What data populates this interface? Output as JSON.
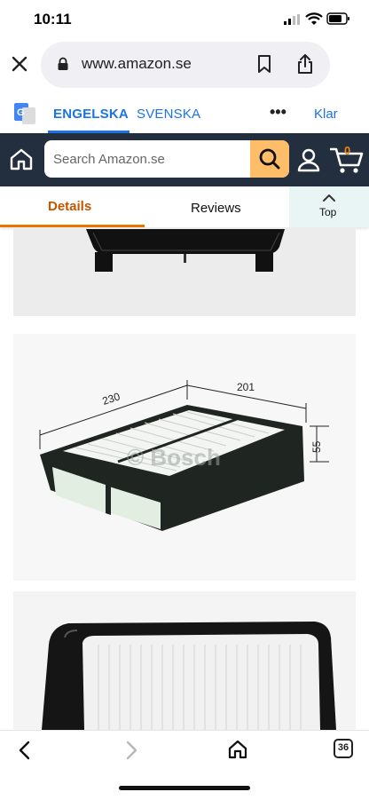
{
  "status_bar": {
    "time": "10:11"
  },
  "browser": {
    "url": "www.amazon.se"
  },
  "translate_bar": {
    "source_language": "ENGELSKA",
    "target_language": "SVENSKA",
    "more": "•••",
    "done": "Klar"
  },
  "amazon_header": {
    "search_placeholder": "Search Amazon.se",
    "cart_count": "0"
  },
  "tabs": {
    "details": "Details",
    "reviews": "Reviews",
    "top": "Top"
  },
  "product_images": {
    "diagram": {
      "dim_length": "230",
      "dim_width": "201",
      "dim_height": "55",
      "watermark": "© Bosch"
    }
  },
  "bottom_toolbar": {
    "tab_count": "36"
  },
  "colors": {
    "amazon_header_bg": "#232f3e",
    "search_button": "#febd69",
    "tab_active": "#c45500",
    "translate_blue": "#1a73e8"
  },
  "icons": {
    "close": "close-icon",
    "lock": "lock-icon",
    "bookmark": "bookmark-icon",
    "share": "share-icon",
    "translate": "google-translate-icon",
    "home": "home-icon",
    "search": "search-icon",
    "account": "account-icon",
    "cart": "cart-icon",
    "back": "back-arrow-icon",
    "forward": "forward-arrow-icon",
    "tabs": "tabs-icon"
  }
}
